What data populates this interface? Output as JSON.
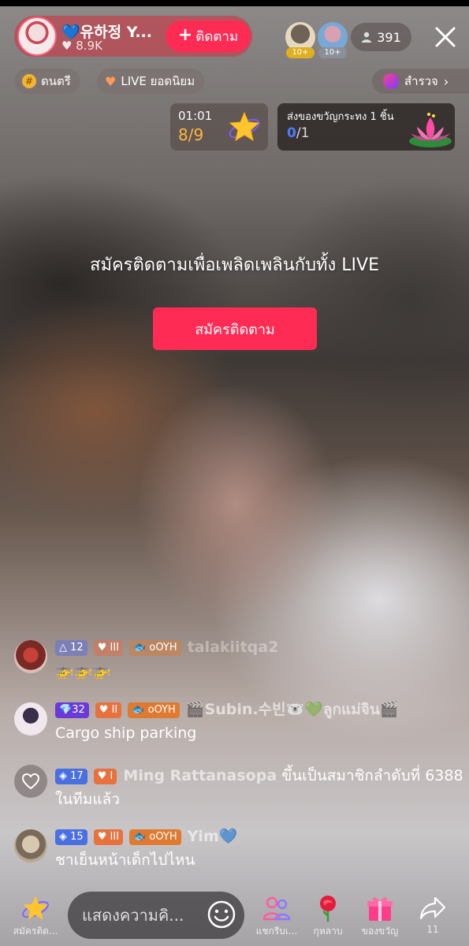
{
  "host": {
    "name": "💙유하정 Y...",
    "likes": "8.9K",
    "follow_label": "ติดตาม",
    "viewer_badges": [
      "10+",
      "10+"
    ],
    "viewer_count": "391"
  },
  "chips": [
    {
      "label": "ดนตรี",
      "icon": "hash-icon"
    },
    {
      "label": "LIVE ยอดนิยม",
      "icon": "heart-icon"
    }
  ],
  "explore_label": "สำรวจ",
  "timer": {
    "time": "01:01",
    "progress": "8/9"
  },
  "gift_task": {
    "title": "ส่งของขวัญกระทง 1 ชิ้น",
    "done": "0",
    "total": "/1"
  },
  "subscribe": {
    "prompt": "สมัครติดตามเพื่อเพลิดเพลินกับทั้ง LIVE",
    "button": "สมัครติดตาม"
  },
  "comments": [
    {
      "level": "12",
      "fan": "III",
      "club": "oOYH",
      "user": "talakiitqa2",
      "message": "🚁🚁🚁"
    },
    {
      "level": "32",
      "fan": "II",
      "club": "oOYH",
      "user": "🎬Subin.수빈🐻‍❄️💚ลูกแม่จิน🎬",
      "message": "Cargo ship parking"
    },
    {
      "level": "17",
      "fan": "I",
      "user": "Ming Rattanasopa",
      "message": "ขึ้นเป็นสมาชิกลำดับที่ 6388 ในทีมแล้ว"
    },
    {
      "level": "15",
      "fan": "III",
      "club": "oOYH",
      "user": "Yim💙",
      "message": "ชาเย็นหน้าเด็กไปไหน"
    }
  ],
  "bottom": {
    "subscribe_label": "สมัครติด...",
    "input_placeholder": "แสดงความคิ...",
    "share_group_label": "แชกรีบเ...",
    "rose_label": "กุหลาบ",
    "gift_label": "ของขวัญ",
    "share_count": "11"
  },
  "colors": {
    "accent": "#fe2c55",
    "timer_progress": "#ffb53e"
  }
}
